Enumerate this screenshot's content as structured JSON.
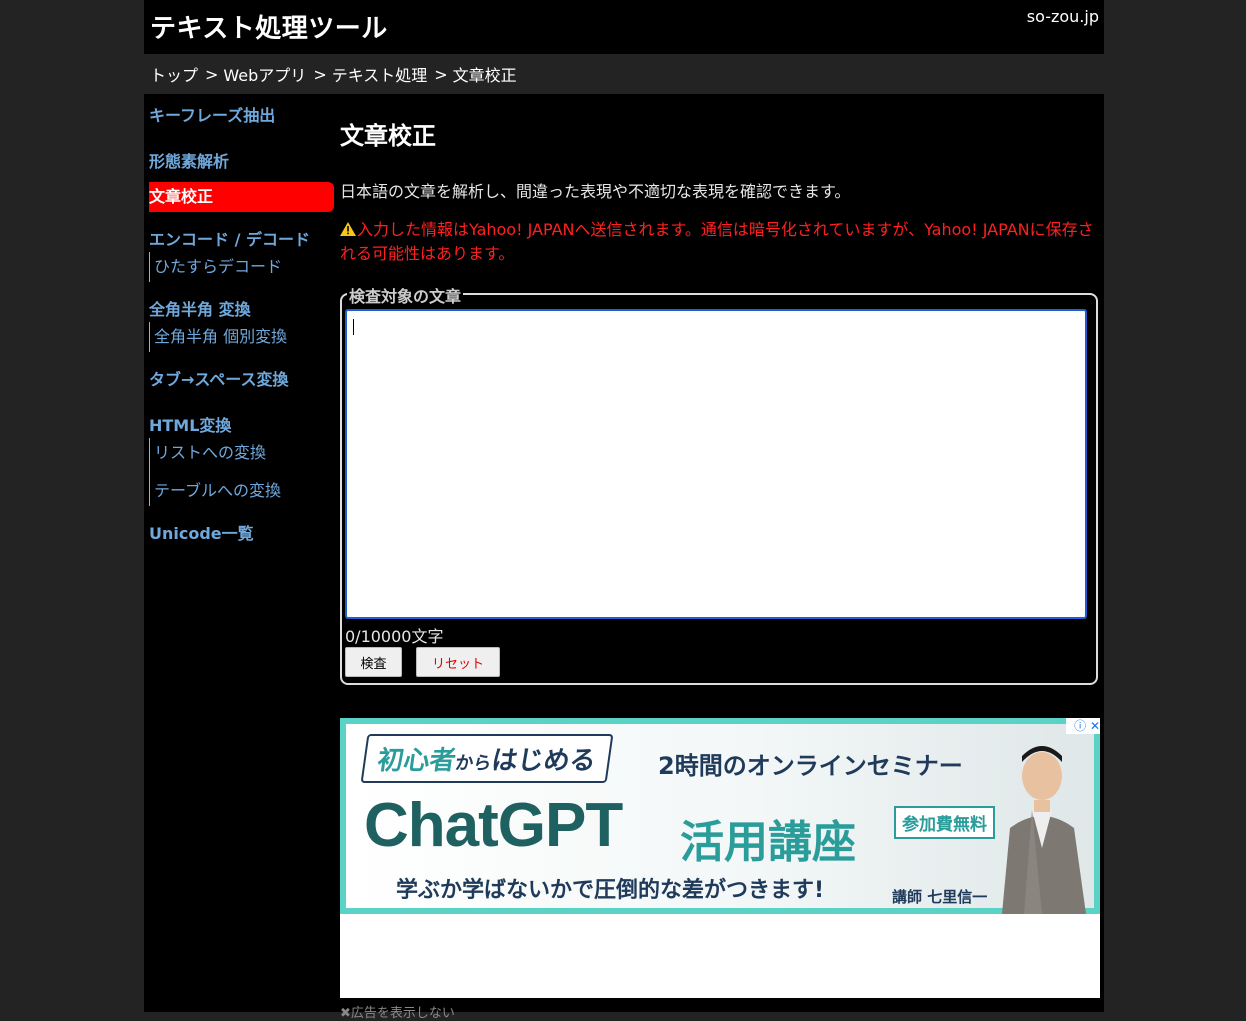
{
  "header": {
    "title": "テキスト処理ツール",
    "domain": "so-zou.jp"
  },
  "breadcrumb": [
    "トップ",
    "Webアプリ",
    "テキスト処理",
    "文章校正"
  ],
  "breadcrumb_separator": ">",
  "sidebar": {
    "items": [
      {
        "label": "キーフレーズ抽出"
      },
      {
        "label": "形態素解析"
      },
      {
        "label": "文章校正",
        "active": true
      },
      {
        "label": "エンコード / デコード",
        "children": [
          "ひたすらデコード"
        ]
      },
      {
        "label": "全角半角 変換",
        "children": [
          "全角半角 個別変換"
        ]
      },
      {
        "label": "タブ→スペース変換"
      },
      {
        "label": "HTML変換",
        "children": [
          "リストへの変換",
          "テーブルへの変換"
        ]
      },
      {
        "label": "Unicode一覧"
      }
    ]
  },
  "main": {
    "title": "文章校正",
    "description": "日本語の文章を解析し、間違った表現や不適切な表現を確認できます。",
    "warning": "入力した情報はYahoo! JAPANへ送信されます。通信は暗号化されていますが、Yahoo! JAPANに保存される可能性はあります。",
    "fieldset_legend": "検査対象の文章",
    "textarea_value": "",
    "char_count": "0/10000文字",
    "check_button": "検査",
    "reset_button": "リセット"
  },
  "ad": {
    "tag_part1": "初心者",
    "tag_part2": "から",
    "tag_part3": "はじめる",
    "subtitle": "2時間のオンラインセミナー",
    "main_text": "ChatGPT",
    "main_text2": "活用講座",
    "free_badge": "参加費無料",
    "catchphrase": "学ぶか学ばないかで圧倒的な差がつきます!",
    "teacher": "講師 七里信一",
    "close_label": "ⓘ ✕",
    "hide_link": "✖広告を表示しない"
  },
  "colors": {
    "accent_red": "#ff0000",
    "link_blue": "#6fa8dc",
    "warning_red": "#ff2020",
    "ad_teal": "#2a9d9b"
  }
}
